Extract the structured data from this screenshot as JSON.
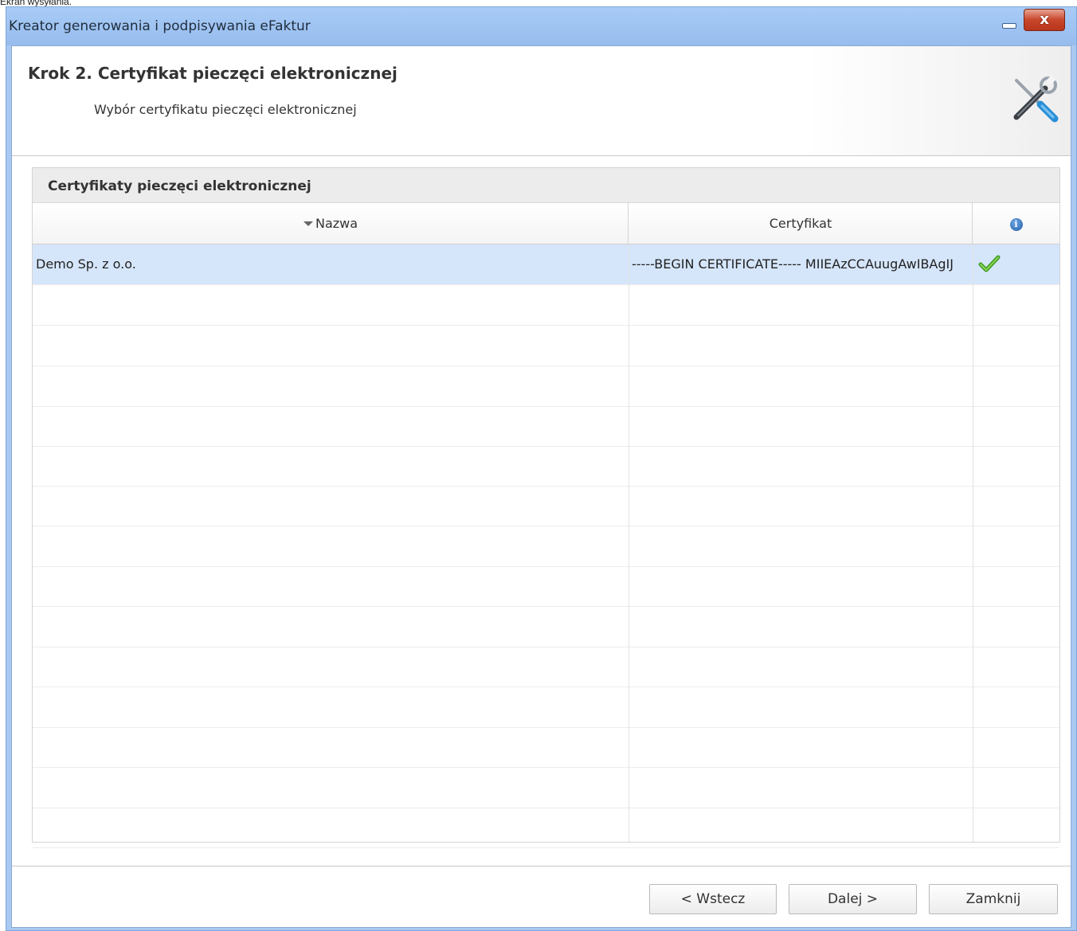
{
  "page_caption": "Ekran wysyłania.",
  "window": {
    "title": "Kreator generowania i podpisywania eFaktur",
    "close_label": "x"
  },
  "header": {
    "step_title": "Krok 2. Certyfikat pieczęci elektronicznej",
    "step_subtitle": "Wybór certyfikatu pieczęci elektronicznej"
  },
  "panel": {
    "title": "Certyfikaty pieczęci elektronicznej",
    "columns": {
      "name": "Nazwa",
      "certificate": "Certyfikat",
      "info_glyph": "i"
    },
    "rows": [
      {
        "name": "Demo Sp. z o.o.",
        "certificate": "-----BEGIN CERTIFICATE----- MIIEAzCCAuugAwIBAgIJ",
        "status_icon": "check-icon"
      }
    ]
  },
  "buttons": {
    "back": "< Wstecz",
    "next": "Dalej >",
    "close": "Zamknij"
  },
  "colors": {
    "titlebar": "#a8cbf6",
    "selected_row": "#d5e6fb",
    "close_button": "#c8462c",
    "check": "#5fb832"
  }
}
